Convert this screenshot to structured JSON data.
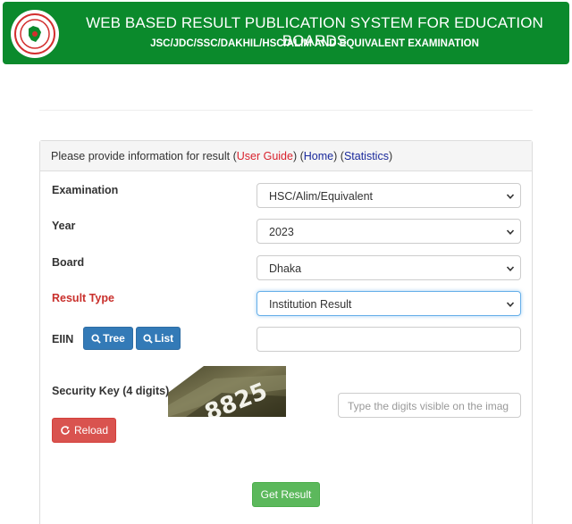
{
  "header": {
    "title": "WEB BASED RESULT PUBLICATION SYSTEM FOR EDUCATION BOARDS",
    "subtitle": "JSC/JDC/SSC/DAKHIL/HSC/ALIM AND EQUIVALENT EXAMINATION"
  },
  "panel": {
    "intro": "Please provide information for result (",
    "user_guide": "User Guide",
    "sep1": ") (",
    "home": "Home",
    "sep2": ") (",
    "statistics": "Statistics",
    "close": ")"
  },
  "form": {
    "examination_label": "Examination",
    "examination_value": "HSC/Alim/Equivalent",
    "year_label": "Year",
    "year_value": "2023",
    "board_label": "Board",
    "board_value": "Dhaka",
    "result_type_label": "Result Type",
    "result_type_value": "Institution Result",
    "eiin_label": "EIIN",
    "tree_label": "Tree",
    "list_label": "List",
    "eiin_value": "",
    "security_label": "Security Key (4 digits)",
    "captcha_text": "8825",
    "security_placeholder": "Type the digits visible on the imag",
    "reload_label": "Reload",
    "submit_label": "Get Result"
  },
  "colors": {
    "header_bg": "#0b8a2c",
    "primary": "#337ab7",
    "danger": "#d9534f",
    "success": "#5cb85c"
  }
}
